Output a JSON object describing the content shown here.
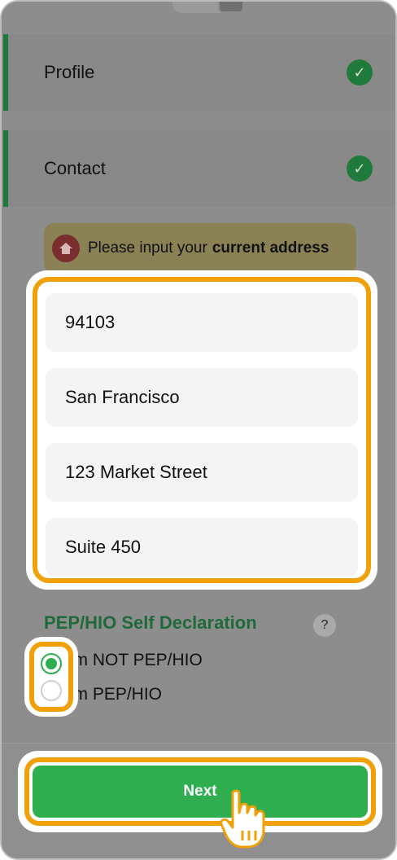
{
  "sections": [
    {
      "label": "Profile",
      "status_icon": "check-circle-icon"
    },
    {
      "label": "Contact",
      "status_icon": "check-circle-icon"
    }
  ],
  "notice": {
    "icon": "home-icon",
    "text": "Please input your",
    "emphasis": "current address"
  },
  "address_fields": [
    {
      "value": "94103"
    },
    {
      "value": "San Francisco"
    },
    {
      "value": "123 Market Street"
    },
    {
      "value": "Suite 450"
    }
  ],
  "pep": {
    "title": "PEP/HIO Self Declaration",
    "help": "?",
    "options": [
      {
        "label": "I’m NOT PEP/HIO",
        "selected": true
      },
      {
        "label": "I’m PEP/HIO",
        "selected": false
      }
    ]
  },
  "footer": {
    "next_label": "Next"
  },
  "colors": {
    "accent_green": "#2fae50",
    "highlight_orange": "#f0a008",
    "dark_green": "#1f7a3c"
  }
}
